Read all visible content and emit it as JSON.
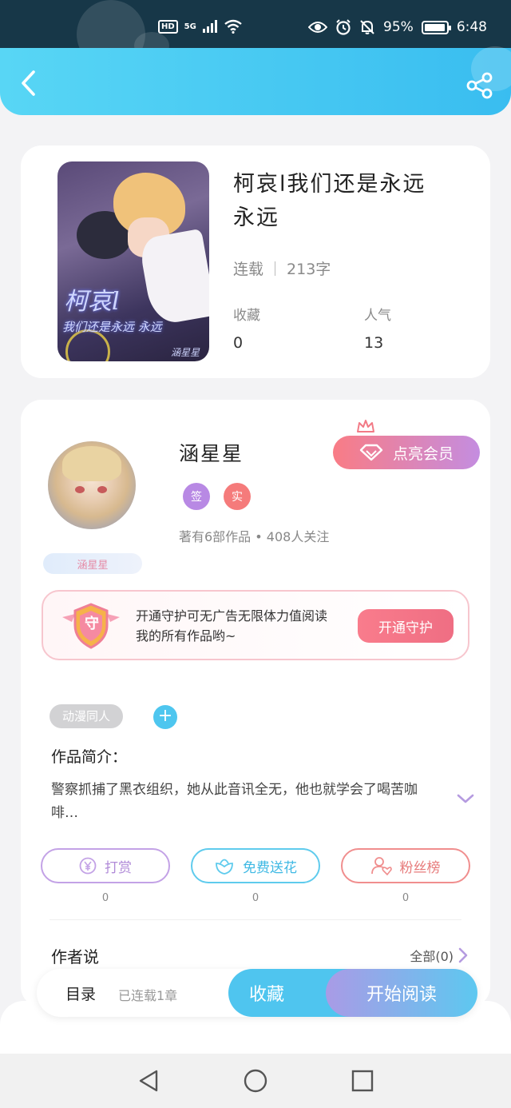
{
  "status_bar": {
    "hd": "HD",
    "network": "5G",
    "battery_percent": "95%",
    "time": "6:48"
  },
  "book": {
    "title": "柯哀l我们还是永远永远",
    "status": "连载",
    "word_count": "213字",
    "favorites_label": "收藏",
    "favorites_value": "0",
    "popularity_label": "人气",
    "popularity_value": "13",
    "cover": {
      "title_text": "柯哀l",
      "subtitle_text": "我们还是永远 永远",
      "author_text": "涵星星"
    }
  },
  "author": {
    "name": "涵星星",
    "vip_button": "点亮会员",
    "badges": [
      {
        "label": "签",
        "color": "#b889e4"
      },
      {
        "label": "实",
        "color": "#f57b7b"
      }
    ],
    "stats": "著有6部作品 • 408人关注",
    "ribbon_name": "涵星星"
  },
  "guard": {
    "badge_char": "守",
    "text": "开通守护可无广告无限体力值阅读我的所有作品哟~",
    "button": "开通守护"
  },
  "intro": {
    "genre_tag": "动漫同人",
    "add_symbol": "+",
    "label": "作品简介：",
    "text": "警察抓捕了黑衣组织，她从此音讯全无，他也就学会了喝苦咖啡…"
  },
  "actions": [
    {
      "label": "打赏",
      "count": "0",
      "icon": "yen-icon",
      "color": "#c3a2e6",
      "text_color": "#b08ad8"
    },
    {
      "label": "免费送花",
      "count": "0",
      "icon": "flower-icon",
      "color": "#5fcbed",
      "text_color": "#3fb9e4"
    },
    {
      "label": "粉丝榜",
      "count": "0",
      "icon": "fan-rank-icon",
      "color": "#f08e8e",
      "text_color": "#e77b7b"
    }
  ],
  "author_says": {
    "label": "作者说",
    "all_link": "全部(0)"
  },
  "bottom_bar": {
    "toc_label": "目录",
    "toc_status": "已连载1章",
    "favorite_button": "收藏",
    "read_button": "开始阅读"
  },
  "colors": {
    "header_gradient": [
      "#58d6f5",
      "#39bdf0"
    ],
    "accent_blue": "#4fc5ef",
    "accent_pink": "#f97c85"
  }
}
